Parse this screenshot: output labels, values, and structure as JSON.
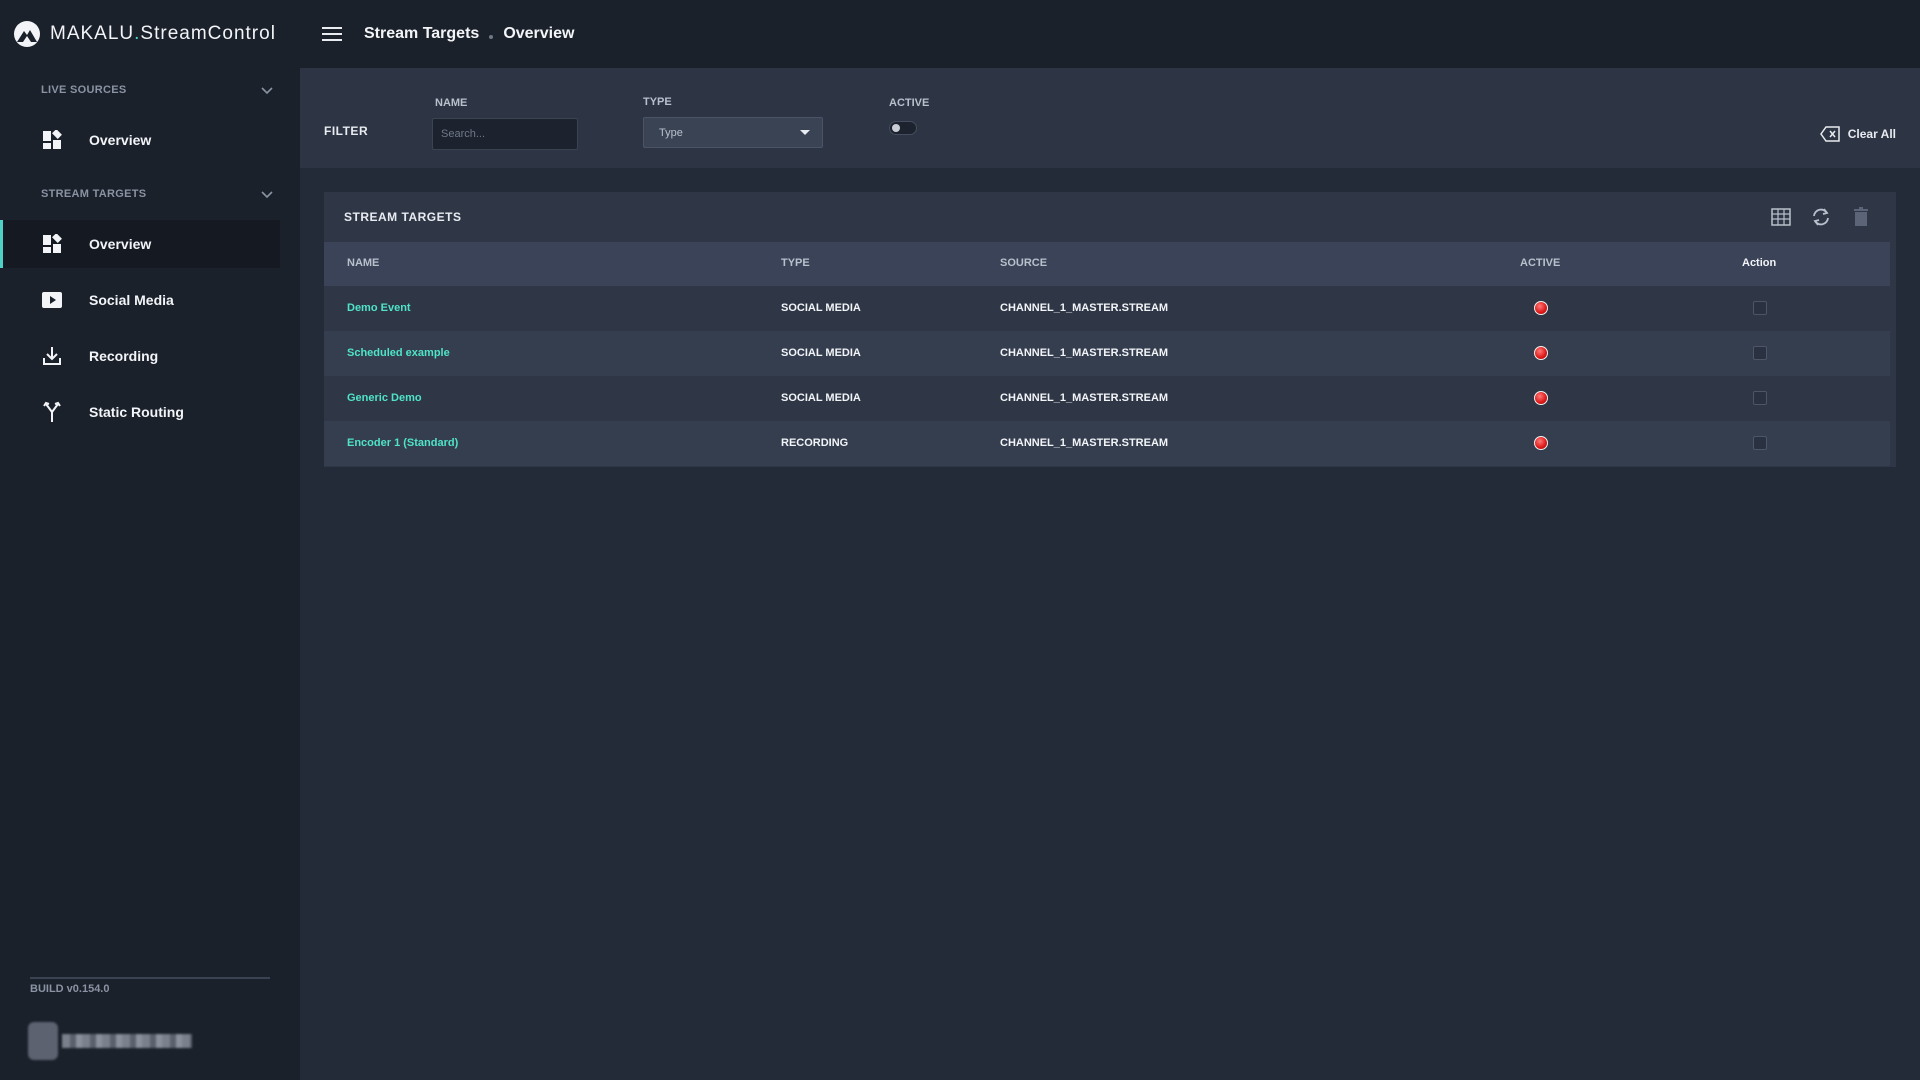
{
  "app": {
    "brand_name": "MAKALU",
    "brand_dot": ".",
    "brand_product": "StreamControl"
  },
  "breadcrumb": {
    "section": "Stream Targets",
    "page": "Overview"
  },
  "sidebar": {
    "live_sources": {
      "title": "LIVE SOURCES",
      "items": [
        {
          "label": "Overview",
          "icon": "dashboard-icon"
        }
      ]
    },
    "stream_targets": {
      "title": "STREAM TARGETS",
      "items": [
        {
          "label": "Overview",
          "icon": "dashboard-icon",
          "active": true
        },
        {
          "label": "Social Media",
          "icon": "play-icon"
        },
        {
          "label": "Recording",
          "icon": "download-icon"
        },
        {
          "label": "Static Routing",
          "icon": "routing-icon"
        }
      ]
    },
    "build": "BUILD v0.154.0"
  },
  "filter": {
    "title": "FILTER",
    "name_label": "NAME",
    "name_placeholder": "Search...",
    "type_label": "TYPE",
    "type_value": "Type",
    "active_label": "ACTIVE",
    "active_on": false,
    "clear_label": "Clear All"
  },
  "table": {
    "title": "STREAM TARGETS",
    "columns": [
      "NAME",
      "TYPE",
      "SOURCE",
      "ACTIVE",
      "Action"
    ],
    "rows": [
      {
        "name": "Demo Event",
        "type": "SOCIAL MEDIA",
        "source": "CHANNEL_1_MASTER.STREAM",
        "active": false
      },
      {
        "name": "Scheduled example",
        "type": "SOCIAL MEDIA",
        "source": "CHANNEL_1_MASTER.STREAM",
        "active": false
      },
      {
        "name": "Generic Demo",
        "type": "SOCIAL MEDIA",
        "source": "CHANNEL_1_MASTER.STREAM",
        "active": false
      },
      {
        "name": "Encoder 1 (Standard)",
        "type": "RECORDING",
        "source": "CHANNEL_1_MASTER.STREAM",
        "active": false
      }
    ]
  },
  "colors": {
    "accent": "#4fd1c5",
    "link": "#4fe3c7",
    "inactive_status": "#e01e1e"
  }
}
